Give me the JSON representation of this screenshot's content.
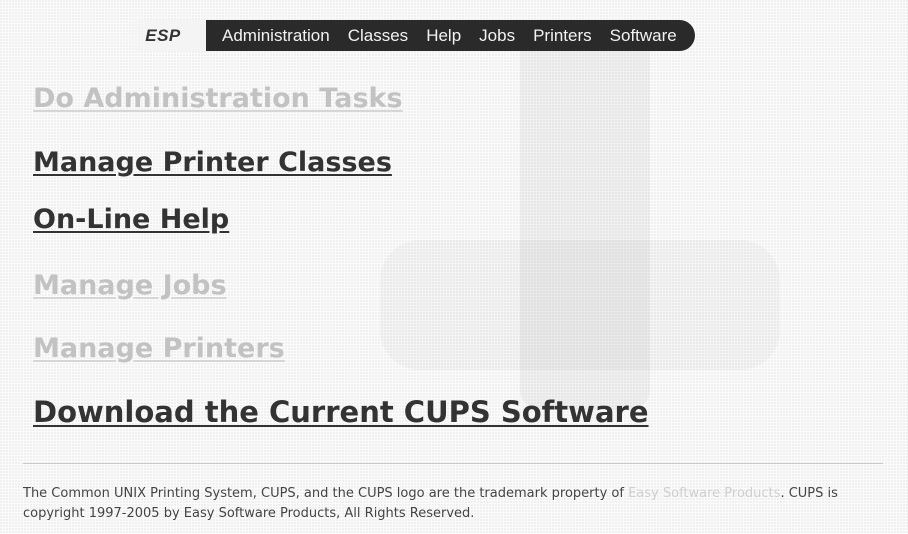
{
  "navbar": {
    "logo_text": "ESP",
    "items": [
      {
        "label": "Administration"
      },
      {
        "label": "Classes"
      },
      {
        "label": "Help"
      },
      {
        "label": "Jobs"
      },
      {
        "label": "Printers"
      },
      {
        "label": "Software"
      }
    ]
  },
  "main": {
    "links": [
      {
        "label": "Do Administration Tasks",
        "style": "light"
      },
      {
        "label": "Manage Printer Classes",
        "style": "dark"
      },
      {
        "label": "On-Line Help",
        "style": "dark"
      },
      {
        "label": "Manage Jobs",
        "style": "light"
      },
      {
        "label": "Manage Printers",
        "style": "light"
      },
      {
        "label": "Download the Current CUPS Software",
        "style": "dark"
      }
    ]
  },
  "footer": {
    "text_before_link": "The Common UNIX Printing System, CUPS, and the CUPS logo are the trademark property of ",
    "link_label": "Easy Software Products",
    "text_after_link": ". CUPS is copyright 1997-2005 by Easy Software Products, All Rights Reserved."
  },
  "colors": {
    "navbar_bg": "#2a2a2a",
    "link_dark": "#333333",
    "link_light": "#c2c2c2"
  }
}
